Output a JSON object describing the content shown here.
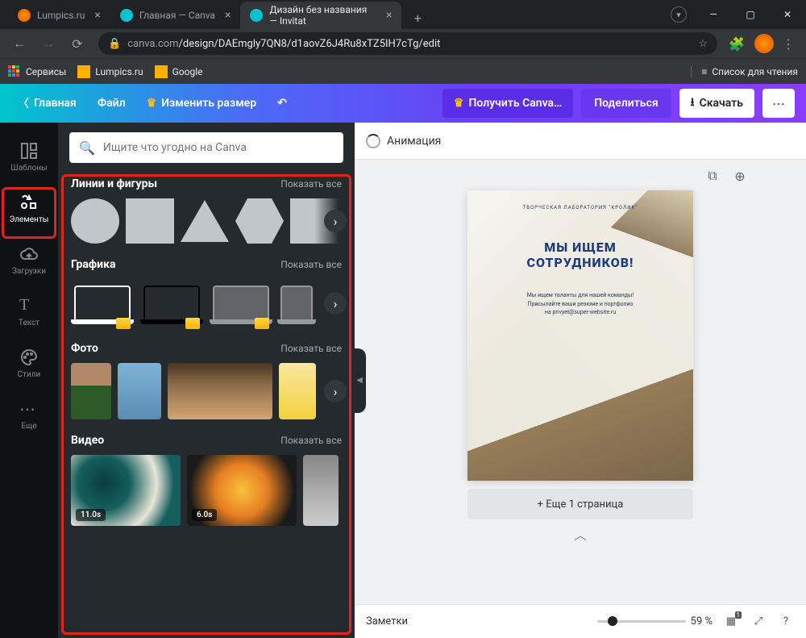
{
  "browser": {
    "tabs": [
      {
        "title": "Lumpics.ru",
        "favicon": "#ff9800"
      },
      {
        "title": "Главная — Canva",
        "favicon": "#00c4cc"
      },
      {
        "title": "Дизайн без названия — Invitat",
        "favicon": "#00c4cc",
        "active": true
      }
    ],
    "url_host": "canva.com",
    "url_path": "/design/DAEmgly7QN8/d1aovZ6J4Ru8xTZ5IH7cTg/edit",
    "bookmarks": {
      "services": "Сервисы",
      "lumpics": "Lumpics.ru",
      "google": "Google",
      "readlist": "Список для чтения"
    }
  },
  "header": {
    "home": "Главная",
    "file": "Файл",
    "resize": "Изменить размер",
    "getpro": "Получить Canva…",
    "share": "Поделиться",
    "download": "Скачать"
  },
  "rail": {
    "templates": "Шаблоны",
    "elements": "Элементы",
    "uploads": "Загрузки",
    "text": "Текст",
    "styles": "Стили",
    "more": "Еще"
  },
  "sidepanel": {
    "search_placeholder": "Ищите что угодно на Canva",
    "showall": "Показать все",
    "sect_lines": "Линии и фигуры",
    "sect_graphics": "Графика",
    "sect_photo": "Фото",
    "sect_video": "Видео",
    "video_dur": [
      "11.0s",
      "6.0s"
    ]
  },
  "toolbar": {
    "animation": "Анимация"
  },
  "page": {
    "tagline": "ТВОРЧЕСКАЯ ЛАБОРАТОРИЯ \"КРОЛИК\"",
    "headline1": "МЫ ИЩЕМ",
    "headline2": "СОТРУДНИКОВ!",
    "body": "Мы ищем таланты для нашей команды! Присылайте ваши резюме и портфолио на privyet@super-website.ru",
    "addpage": "+ Еще 1 страница"
  },
  "bottom": {
    "notes": "Заметки",
    "zoom": "59 %",
    "pagecount": "1"
  }
}
